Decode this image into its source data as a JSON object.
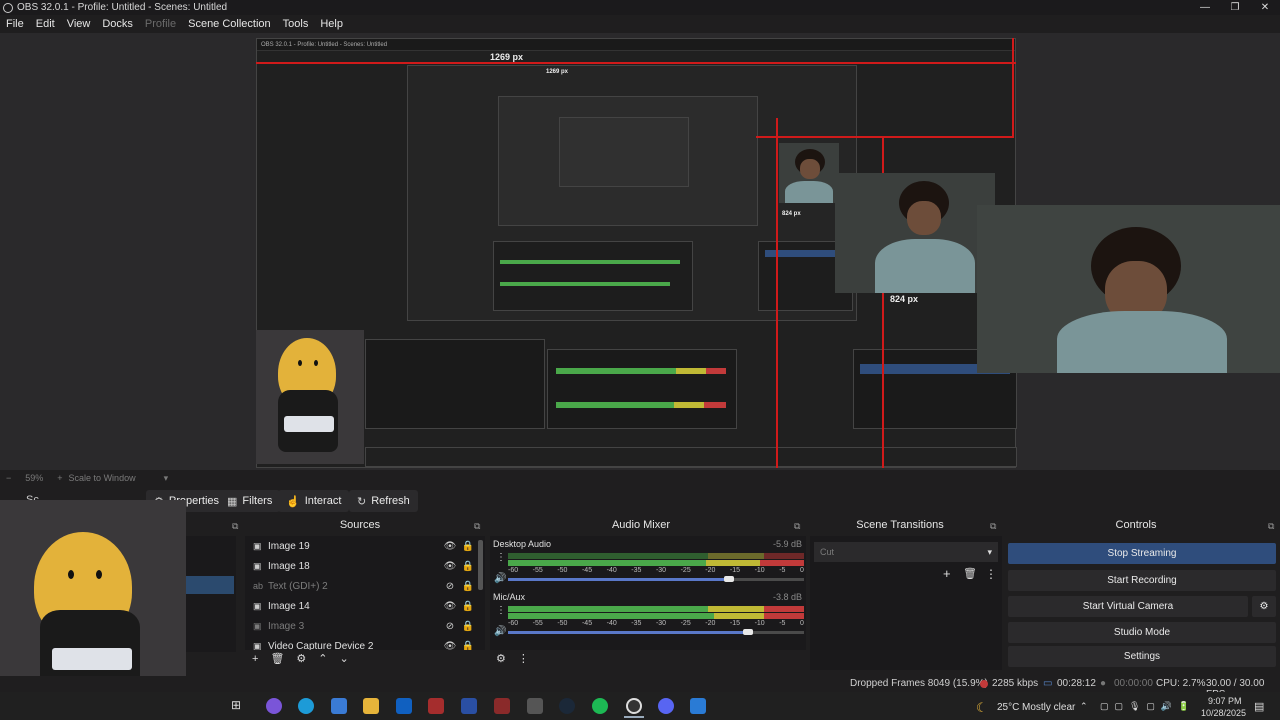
{
  "window": {
    "title": "OBS 32.0.1 - Profile: Untitled - Scenes: Untitled",
    "min": "—",
    "max": "❐",
    "close": "✕"
  },
  "menu": {
    "file": "File",
    "edit": "Edit",
    "view": "View",
    "docks": "Docks",
    "profile": "Profile",
    "scene_collection": "Scene Collection",
    "tools": "Tools",
    "help": "Help"
  },
  "preview": {
    "measure_top": "1269 px",
    "measure_top_inner": "1269 px",
    "measure_side": "824 px",
    "measure_side_inner": "824 px",
    "nested_title": "OBS 32.0.1 - Profile: Untitled - Scenes: Untitled"
  },
  "zoom": {
    "minus": "−",
    "level": "59%",
    "plus": "+",
    "mode": "Scale to Window"
  },
  "toolbar": {
    "scenes_partial": "Sc",
    "properties": "Properties",
    "filters": "Filters",
    "interact": "Interact",
    "refresh": "Refresh"
  },
  "docks": {
    "sources": "Sources",
    "mixer": "Audio Mixer",
    "transitions": "Scene Transitions",
    "controls": "Controls"
  },
  "sources": [
    {
      "name": "Image 19",
      "visible": true
    },
    {
      "name": "Image 18",
      "visible": true
    },
    {
      "name": "Text (GDI+) 2",
      "visible": false
    },
    {
      "name": "Image 14",
      "visible": true
    },
    {
      "name": "Image 3",
      "visible": false
    },
    {
      "name": "Video Capture Device 2",
      "visible": true
    }
  ],
  "mixer": {
    "desktop": {
      "name": "Desktop Audio",
      "db": "-5.9 dB",
      "level": 0.78,
      "volume": 0.78
    },
    "mic": {
      "name": "Mic/Aux",
      "db": "-3.8 dB",
      "level": 0.82,
      "volume": 0.82
    },
    "ticks": [
      "-60",
      "-55",
      "-50",
      "-45",
      "-40",
      "-35",
      "-30",
      "-25",
      "-20",
      "-15",
      "-10",
      "-5",
      "0"
    ]
  },
  "transitions": {
    "selected": "Cut"
  },
  "controls": {
    "stop_streaming": "Stop Streaming",
    "start_recording": "Start Recording",
    "start_virtual_camera": "Start Virtual Camera",
    "studio_mode": "Studio Mode",
    "settings": "Settings"
  },
  "status": {
    "dropped": "Dropped Frames 8049 (15.9%)",
    "bitrate": "2285 kbps",
    "stream_time": "00:28:12",
    "rec_time": "00:00:00",
    "cpu": "CPU: 2.7%",
    "fps": "30.00 / 30.00 FPS"
  },
  "tray": {
    "temp": "25°C",
    "weather": "Mostly clear",
    "time": "9:07 PM",
    "date": "10/28/2025"
  },
  "colors": {
    "accent": "#2f4d7c",
    "red": "#d01a1a",
    "meter_green": "#4aa84a",
    "meter_yellow": "#c0b935",
    "meter_red": "#c23a3a"
  }
}
